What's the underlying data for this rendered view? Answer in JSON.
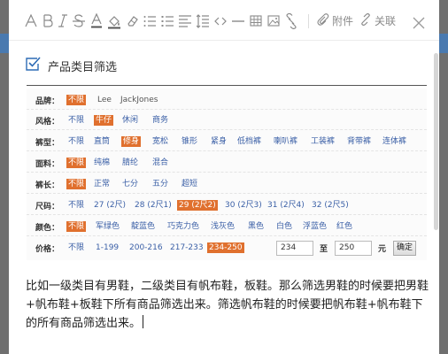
{
  "toolbar": {
    "attachment_label": "附件",
    "link_label": "关联"
  },
  "doc": {
    "title": "产品类目筛选"
  },
  "filters": {
    "brand": {
      "label": "品牌：",
      "options": [
        "不限",
        "Lee",
        "JackJones"
      ]
    },
    "style": {
      "label": "风格：",
      "options": [
        "不限",
        "牛仔",
        "休闲",
        "商务"
      ]
    },
    "fit": {
      "label": "裤型：",
      "options": [
        "不限",
        "直筒",
        "修身",
        "宽松",
        "锥形",
        "紧身",
        "低档裤",
        "喇叭裤",
        "工装裤",
        "背带裤",
        "连体裤"
      ]
    },
    "fabric": {
      "label": "面料：",
      "options": [
        "不限",
        "纯棉",
        "腈纶",
        "混合"
      ]
    },
    "length": {
      "label": "裤长：",
      "options": [
        "不限",
        "正常",
        "七分",
        "五分",
        "超短"
      ]
    },
    "size": {
      "label": "尺码：",
      "options": [
        "不限",
        "27 (2尺)",
        "28 (2尺1)",
        "29 (2尺2)",
        "30 (2尺3)",
        "31 (2尺4)",
        "32 (2尺5)"
      ]
    },
    "color": {
      "label": "颜色：",
      "options": [
        "不限",
        "军绿色",
        "靛蓝色",
        "巧克力色",
        "浅灰色",
        "黑色",
        "白色",
        "浮蓝色",
        "红色"
      ]
    },
    "price": {
      "label": "价格：",
      "options": [
        "不限",
        "1-199",
        "200-216",
        "217-233",
        "234-250"
      ],
      "min_value": "234",
      "to_label": "至",
      "max_value": "250",
      "unit": "元",
      "confirm_label": "确定"
    }
  },
  "content": {
    "text": "比如一级类目有男鞋，二级类目有帆布鞋，板鞋。那么筛选男鞋的时候要把男鞋+帆布鞋+板鞋下所有商品筛选出来。筛选帆布鞋的时候要把帆布鞋+帆布鞋下的所有商品筛选出来。"
  },
  "colors": {
    "selected_option": "#e0702e",
    "option_link": "#3a5fa6",
    "toolbar_icon": "#8a8a8a"
  }
}
